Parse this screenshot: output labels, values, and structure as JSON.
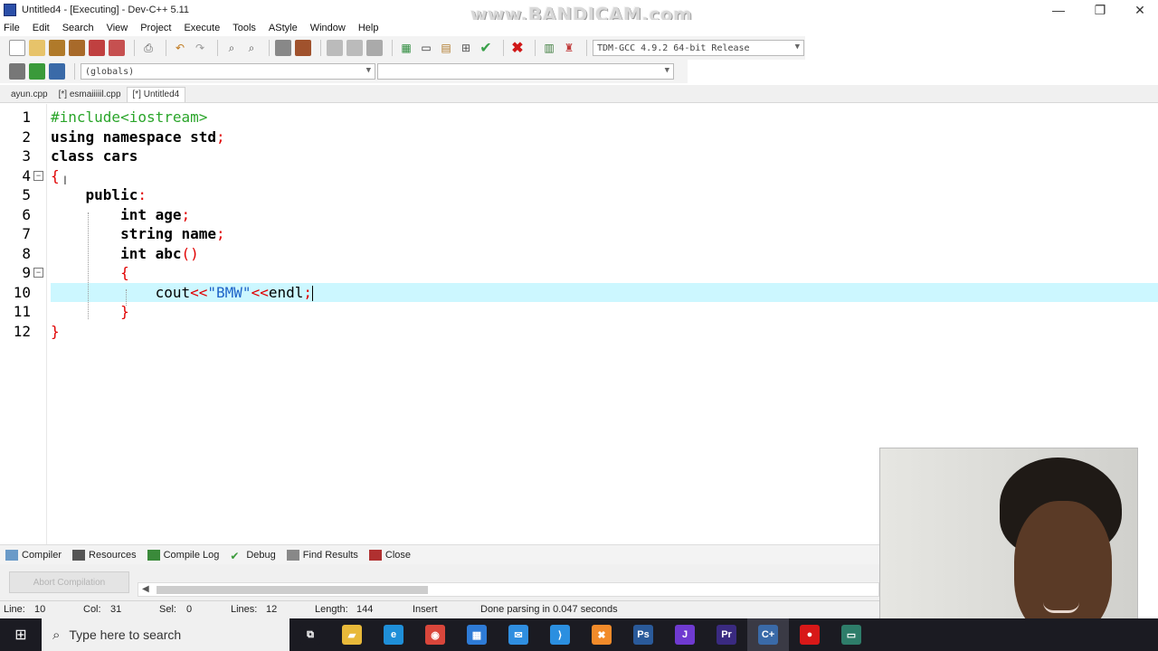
{
  "window": {
    "title": "Untitled4 - [Executing] - Dev-C++ 5.11",
    "watermark": "www.BANDICAM.com",
    "controls": {
      "minimize": "—",
      "maximize": "❐",
      "close": "✕"
    }
  },
  "menu": [
    "File",
    "Edit",
    "Search",
    "View",
    "Project",
    "Execute",
    "Tools",
    "AStyle",
    "Window",
    "Help"
  ],
  "toolbar": {
    "compiler_select": "TDM-GCC 4.9.2 64-bit Release",
    "globals_select": "(globals)",
    "second_select": ""
  },
  "file_tabs": [
    {
      "label": "ayun.cpp",
      "active": false
    },
    {
      "label": "[*] esmaiiiiil.cpp",
      "active": false
    },
    {
      "label": "[*] Untitled4",
      "active": true
    }
  ],
  "editor": {
    "current_line": 10,
    "lines": [
      {
        "n": "1",
        "tokens": [
          {
            "t": "#include<iostream>",
            "c": "pre"
          }
        ]
      },
      {
        "n": "2",
        "tokens": [
          {
            "t": "using namespace std",
            "c": "kw"
          },
          {
            "t": ";",
            "c": "sym"
          }
        ]
      },
      {
        "n": "3",
        "tokens": [
          {
            "t": "class cars",
            "c": "kw"
          }
        ]
      },
      {
        "n": "4",
        "tokens": [
          {
            "t": "{",
            "c": "sym"
          }
        ]
      },
      {
        "n": "5",
        "tokens": [
          {
            "t": "    public",
            "c": "kw"
          },
          {
            "t": ":",
            "c": "sym"
          }
        ]
      },
      {
        "n": "6",
        "tokens": [
          {
            "t": "        int age",
            "c": "kw"
          },
          {
            "t": ";",
            "c": "sym"
          }
        ]
      },
      {
        "n": "7",
        "tokens": [
          {
            "t": "        string name",
            "c": "kw"
          },
          {
            "t": ";",
            "c": "sym"
          }
        ]
      },
      {
        "n": "8",
        "tokens": [
          {
            "t": "        int abc",
            "c": "kw"
          },
          {
            "t": "()",
            "c": "sym"
          }
        ]
      },
      {
        "n": "9",
        "tokens": [
          {
            "t": "        {",
            "c": "sym"
          }
        ]
      },
      {
        "n": "10",
        "tokens": [
          {
            "t": "            cout",
            "c": ""
          },
          {
            "t": "<<",
            "c": "sym"
          },
          {
            "t": "\"BMW\"",
            "c": "str"
          },
          {
            "t": "<<",
            "c": "sym"
          },
          {
            "t": "endl",
            "c": ""
          },
          {
            "t": ";",
            "c": "sym"
          }
        ]
      },
      {
        "n": "11",
        "tokens": [
          {
            "t": "        }",
            "c": "sym"
          }
        ]
      },
      {
        "n": "12",
        "tokens": [
          {
            "t": "}",
            "c": "sym"
          }
        ]
      }
    ]
  },
  "bottom_tabs": [
    "Compiler",
    "Resources",
    "Compile Log",
    "Debug",
    "Find Results",
    "Close"
  ],
  "bottom_panel": {
    "abort_button": "Abort Compilation"
  },
  "status": {
    "line_label": "Line:",
    "line_value": "10",
    "col_label": "Col:",
    "col_value": "31",
    "sel_label": "Sel:",
    "sel_value": "0",
    "lines_label": "Lines:",
    "lines_value": "12",
    "length_label": "Length:",
    "length_value": "144",
    "mode": "Insert",
    "message": "Done parsing in 0.047 seconds"
  },
  "taskbar": {
    "search_placeholder": "Type here to search",
    "apps": [
      {
        "name": "task-view",
        "glyph": "⧉",
        "color": "#1b1b22"
      },
      {
        "name": "file-explorer",
        "glyph": "▰",
        "color": "#e8b93a"
      },
      {
        "name": "edge",
        "glyph": "e",
        "color": "#1f8fd8"
      },
      {
        "name": "chrome",
        "glyph": "◉",
        "color": "#d9463b"
      },
      {
        "name": "store",
        "glyph": "▦",
        "color": "#2e7bd6"
      },
      {
        "name": "mail",
        "glyph": "✉",
        "color": "#2f8ee0"
      },
      {
        "name": "vscode",
        "glyph": "⟩",
        "color": "#2b8fe0"
      },
      {
        "name": "xampp",
        "glyph": "✖",
        "color": "#f28b2a"
      },
      {
        "name": "photoshop",
        "glyph": "Ps",
        "color": "#2a5a9a"
      },
      {
        "name": "jetbrains",
        "glyph": "J",
        "color": "#6f3ad0"
      },
      {
        "name": "premiere",
        "glyph": "Pr",
        "color": "#3a2a80"
      },
      {
        "name": "devcpp",
        "glyph": "C+",
        "color": "#3a6aa8"
      },
      {
        "name": "bandicam",
        "glyph": "●",
        "color": "#d81818"
      },
      {
        "name": "console",
        "glyph": "▭",
        "color": "#2e7d6a"
      }
    ]
  }
}
